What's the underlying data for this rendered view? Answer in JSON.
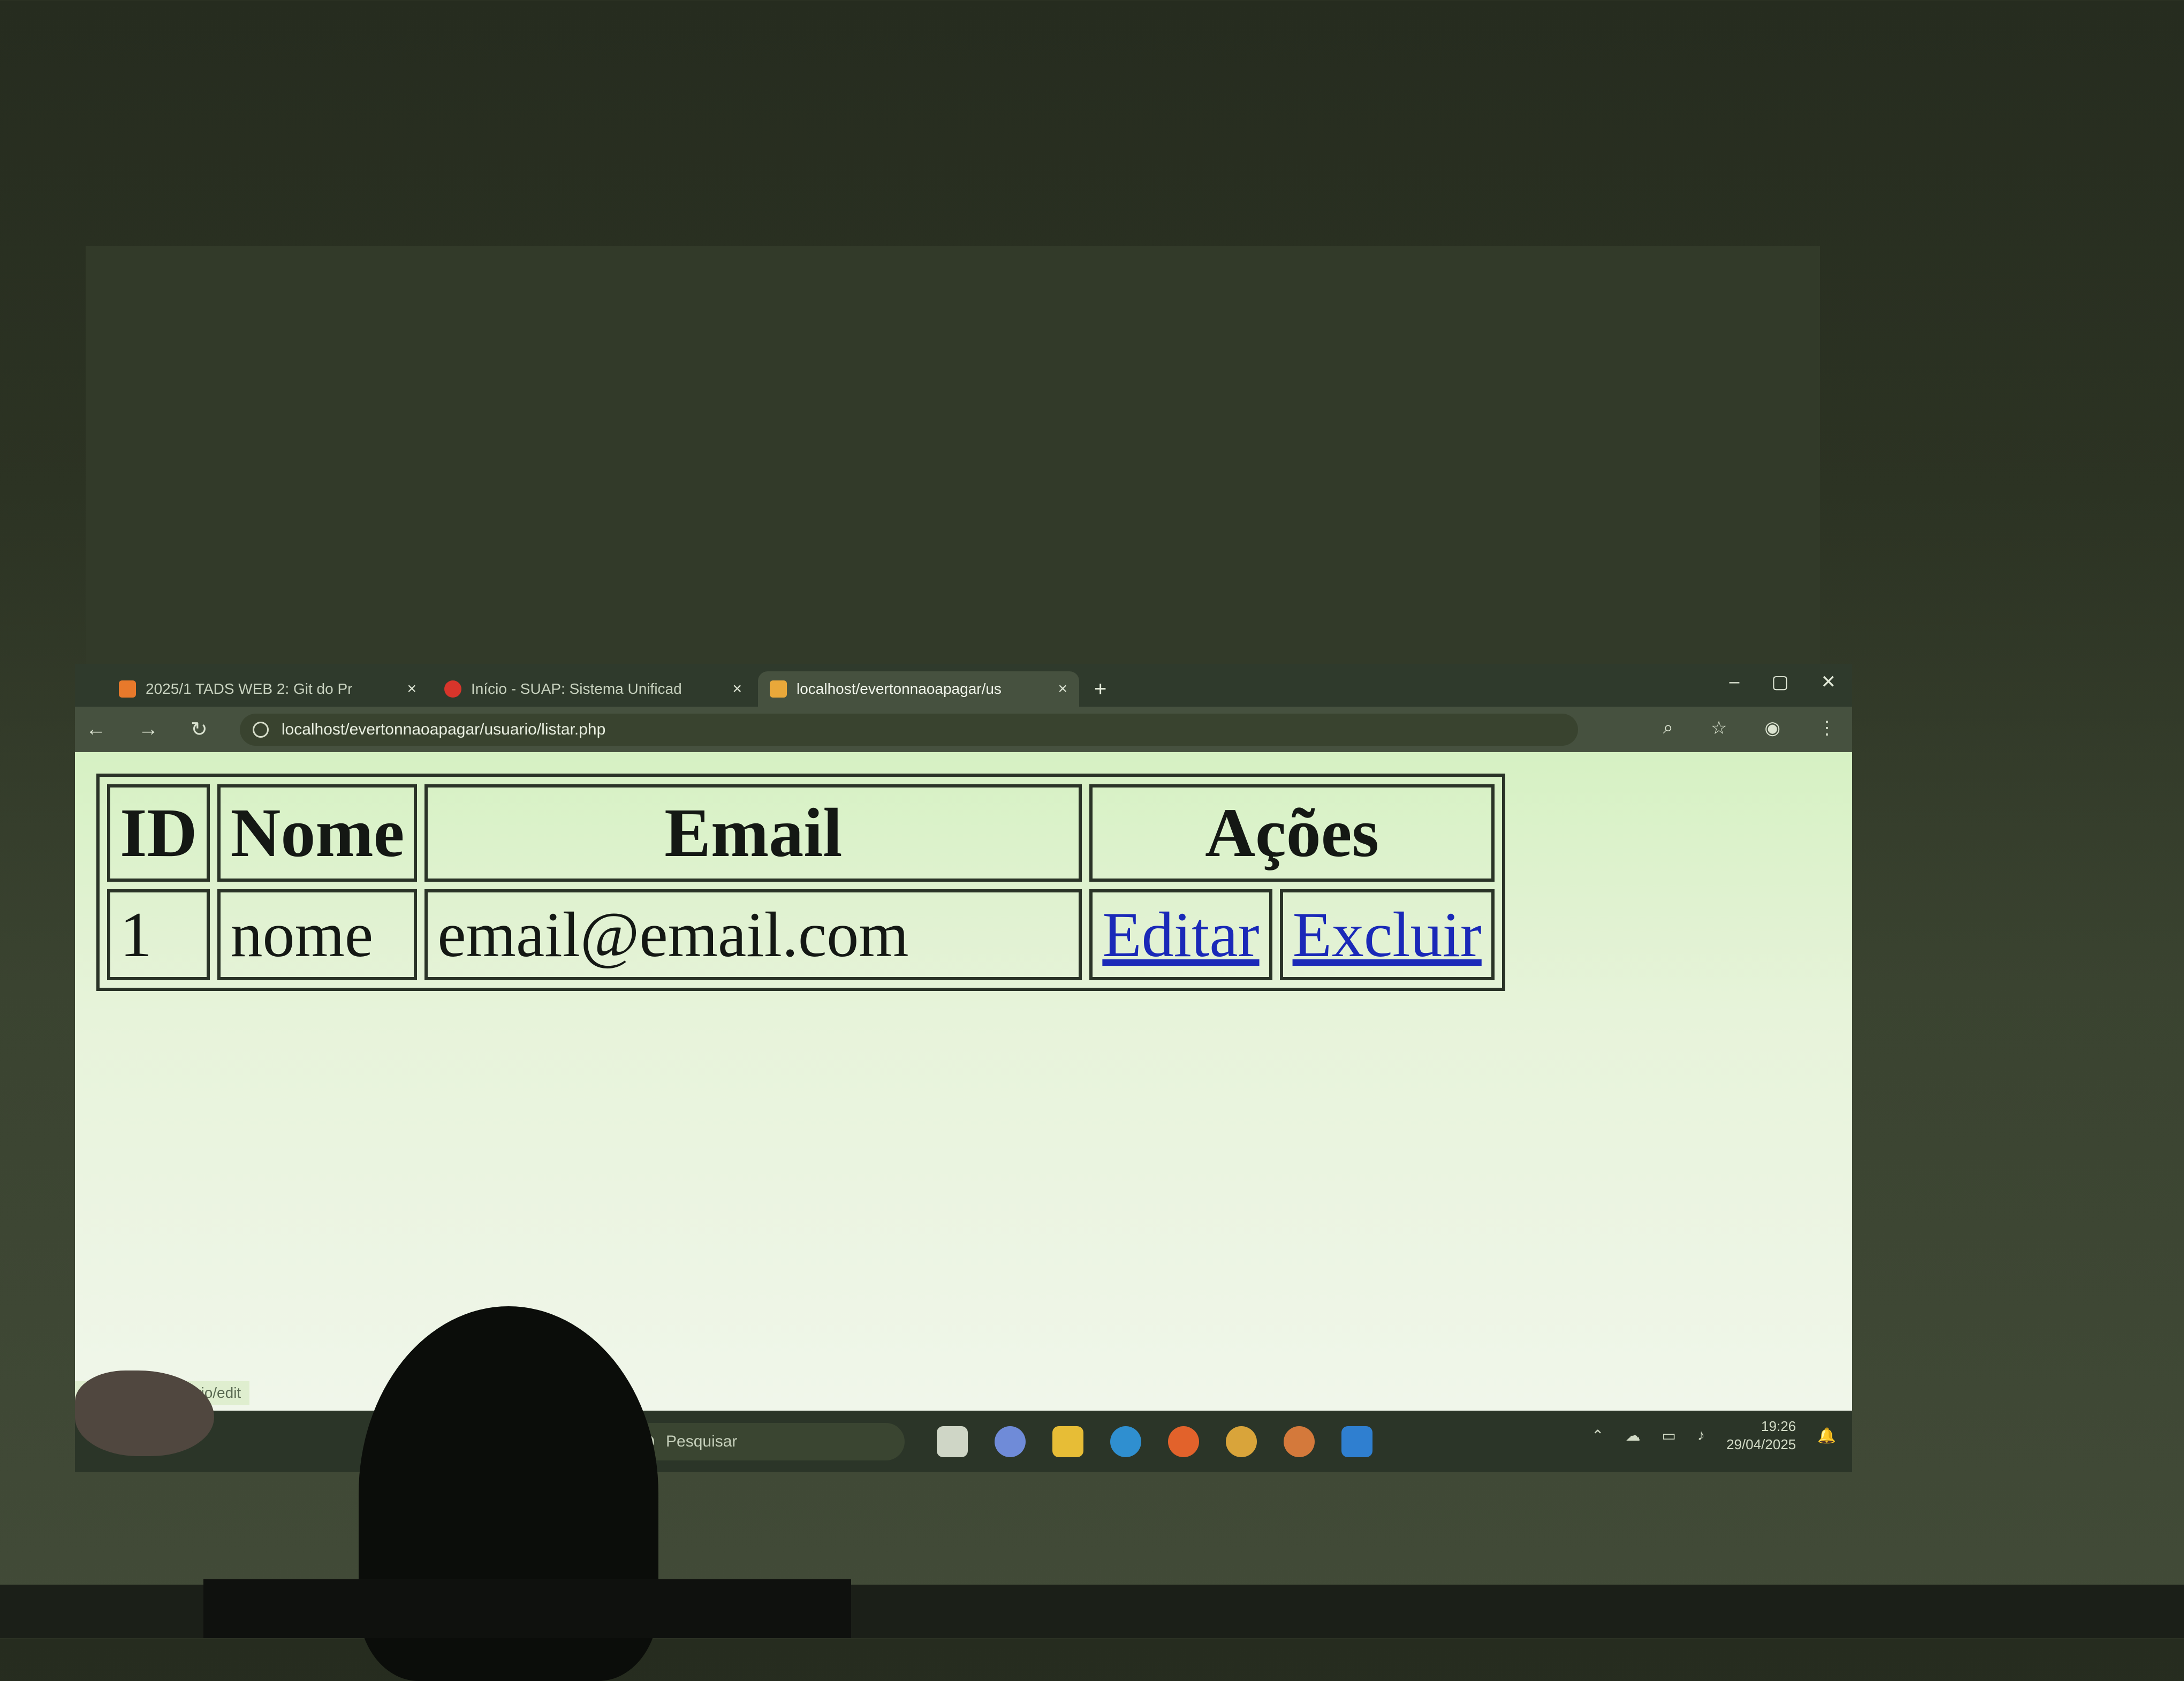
{
  "browser": {
    "tabs": [
      {
        "label": "2025/1 TADS WEB 2: Git do Pr",
        "active": false,
        "favicon_color": "#e8792b"
      },
      {
        "label": "Início - SUAP: Sistema Unificad",
        "active": false,
        "favicon_color": "#d8352b"
      },
      {
        "label": "localhost/evertonnaoapagar/us",
        "active": true,
        "favicon_color": "#e9a83a"
      }
    ],
    "new_tab": "+",
    "window_controls": {
      "minimize": "–",
      "maximize": "▢",
      "close": "✕"
    },
    "nav": {
      "back": "←",
      "forward": "→",
      "reload": "↻"
    },
    "address": "localhost/evertonnaoapagar/usuario/listar.php",
    "toolbar_icons": [
      "zoom-icon",
      "star-icon",
      "profile-icon",
      "menu-icon"
    ],
    "status_url": "...aoapagar/usuario/edit"
  },
  "table": {
    "headers": [
      "ID",
      "Nome",
      "Email",
      "Ações"
    ],
    "rows": [
      {
        "id": "1",
        "nome": "nome",
        "email": "email@email.com",
        "edit_label": "Editar",
        "delete_label": "Excluir"
      }
    ]
  },
  "taskbar": {
    "search_placeholder": "Pesquisar",
    "time": "19:26",
    "date": "29/04/2025",
    "apps": [
      {
        "name": "task-view",
        "color": "#cfd6c6"
      },
      {
        "name": "copilot",
        "color": "#6f8bd8"
      },
      {
        "name": "file-explorer",
        "color": "#e7bd36"
      },
      {
        "name": "edge",
        "color": "#2f8fd0"
      },
      {
        "name": "firefox",
        "color": "#e2622b"
      },
      {
        "name": "chrome",
        "color": "#d9a43a"
      },
      {
        "name": "chrome-profile",
        "color": "#d4793b"
      },
      {
        "name": "vscode",
        "color": "#2f7fd0"
      }
    ]
  },
  "colors": {
    "link": "#1a29b8",
    "page_bg": "#dff3cd"
  }
}
